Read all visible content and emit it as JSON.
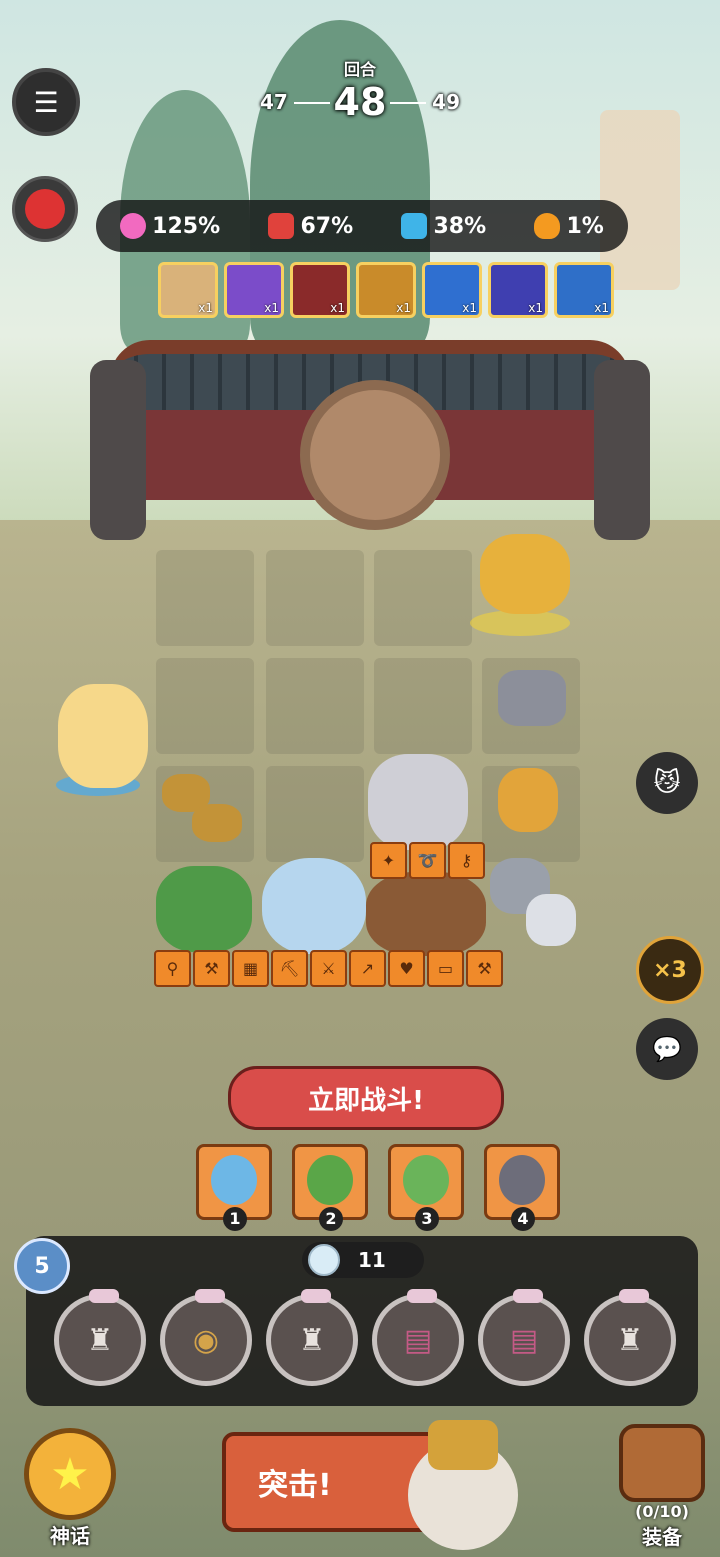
{
  "round": {
    "label": "回合",
    "prev": "47",
    "current": "48",
    "next": "49"
  },
  "stats": [
    {
      "icon": "heart-icon",
      "value": "125%",
      "color": "#f26ac0"
    },
    {
      "icon": "sword-icon",
      "value": "67%",
      "color": "#e0423c"
    },
    {
      "icon": "arrow-icon",
      "value": "38%",
      "color": "#3fb4e8"
    },
    {
      "icon": "fire-icon",
      "value": "1%",
      "color": "#f49a20"
    }
  ],
  "buffs": [
    {
      "icon": "scroll-star-icon",
      "count": "x1",
      "color": "#d9b27a"
    },
    {
      "icon": "magic-ring-icon",
      "count": "x1",
      "color": "#7b4cc9"
    },
    {
      "icon": "wizard-hat-icon",
      "count": "x1",
      "color": "#8a2a2a"
    },
    {
      "icon": "trophy-icon",
      "count": "x1",
      "color": "#c98b2a"
    },
    {
      "icon": "whirlwind-icon",
      "count": "x1",
      "color": "#2f6fd0"
    },
    {
      "icon": "water-spirit-icon",
      "count": "x1",
      "color": "#3f3fb0"
    },
    {
      "icon": "blue-scroll-icon",
      "count": "x1",
      "color": "#2f6fc8"
    }
  ],
  "fight_button": "立即战斗!",
  "speed_label": "×3",
  "portraits": [
    {
      "num": "1",
      "color": "#6db7e6"
    },
    {
      "num": "2",
      "color": "#5aa648"
    },
    {
      "num": "3",
      "color": "#6ab45a"
    },
    {
      "num": "4",
      "color": "#6d6d7a"
    }
  ],
  "level": "5",
  "gems": "11",
  "myth_label": "神话",
  "assault_label": "突击!",
  "equip_count": "(0/10)",
  "equip_label": "装备"
}
